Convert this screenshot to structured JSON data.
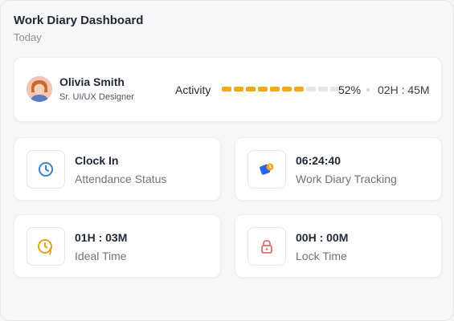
{
  "header": {
    "title": "Work Diary Dashboard",
    "subtitle": "Today"
  },
  "profile": {
    "name": "Olivia Smith",
    "role": "Sr. UI/UX Designer",
    "activity_label": "Activity",
    "activity_percent": 52,
    "activity_percent_text": "52%",
    "activity_segments_total": 10,
    "activity_segments_filled": 7,
    "activity_time": "02H : 45M"
  },
  "stats": [
    {
      "value": "Clock In",
      "label": "Attendance Status",
      "icon": "clock-icon",
      "color": "#3b82c4"
    },
    {
      "value": "06:24:40",
      "label": "Work Diary Tracking",
      "icon": "tracking-icon",
      "color": "#2563eb"
    },
    {
      "value": "01H : 03M",
      "label": "Ideal Time",
      "icon": "idle-clock-icon",
      "color": "#e0a21f"
    },
    {
      "value": "00H : 00M",
      "label": "Lock Time",
      "icon": "lock-icon",
      "color": "#e26b6b"
    }
  ],
  "colors": {
    "accent": "#f2a81d",
    "track": "#e4e6ea"
  }
}
